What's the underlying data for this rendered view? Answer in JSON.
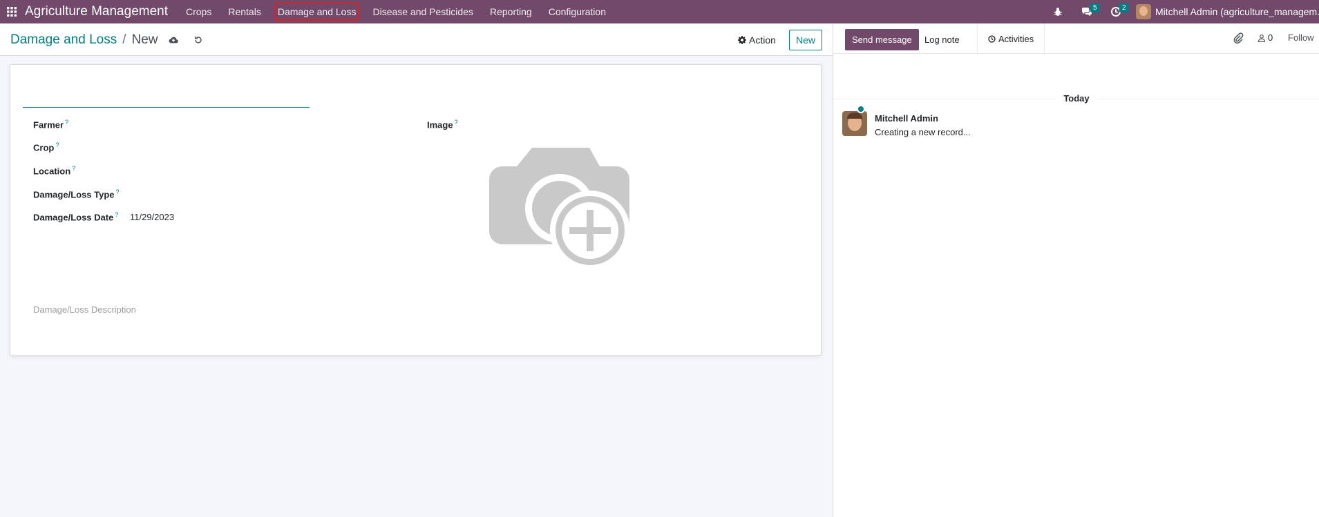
{
  "navbar": {
    "brand": "Agriculture Management",
    "menu": [
      "Crops",
      "Rentals",
      "Damage and Loss",
      "Disease and Pesticides",
      "Reporting",
      "Configuration"
    ],
    "active_menu": "Damage and Loss",
    "messages_count": "5",
    "activities_count": "2",
    "user_name": "Mitchell Admin (agriculture_managem..."
  },
  "control": {
    "breadcrumb_parent": "Damage and Loss",
    "breadcrumb_separator": "/",
    "breadcrumb_current": "New",
    "action_label": "Action",
    "new_label": "New"
  },
  "form": {
    "fields": [
      {
        "label": "Farmer",
        "value": ""
      },
      {
        "label": "Crop",
        "value": ""
      },
      {
        "label": "Location",
        "value": ""
      },
      {
        "label": "Damage/Loss Type",
        "value": ""
      },
      {
        "label": "Damage/Loss Date",
        "value": "11/29/2023"
      }
    ],
    "help_mark": "?",
    "image_label": "Image",
    "description_placeholder": "Damage/Loss Description"
  },
  "chatter": {
    "send_message": "Send message",
    "log_note": "Log note",
    "activities": "Activities",
    "followers_count": "0",
    "follow": "Follow",
    "date_separator": "Today",
    "message": {
      "author": "Mitchell Admin",
      "body": "Creating a new record..."
    }
  },
  "colors": {
    "navbar": "#71496a",
    "accent": "#017e84",
    "highlight_outline": "#e0201f"
  }
}
